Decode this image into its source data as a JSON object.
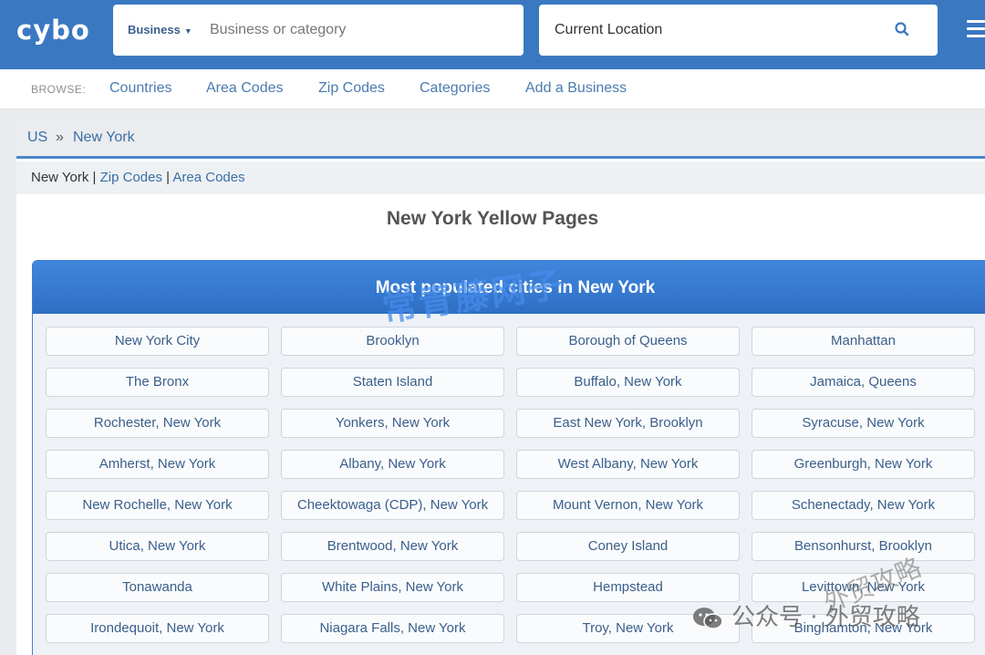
{
  "header": {
    "logo": "cybo",
    "search_type": "Business",
    "search_placeholder": "Business or category",
    "location": "Current Location"
  },
  "browse": {
    "label": "BROWSE:",
    "links": [
      "Countries",
      "Area Codes",
      "Zip Codes",
      "Categories",
      "Add a Business"
    ]
  },
  "breadcrumb": {
    "root": "US",
    "separator": "»",
    "current": "New York"
  },
  "subnav": {
    "current": "New York",
    "sep": " | ",
    "zip": "Zip Codes",
    "area": "Area Codes"
  },
  "page_title": "New York Yellow Pages",
  "cities": {
    "heading": "Most populated cities in New York",
    "items": [
      "New York City",
      "Brooklyn",
      "Borough of Queens",
      "Manhattan",
      "The Bronx",
      "Staten Island",
      "Buffalo, New York",
      "Jamaica, Queens",
      "Rochester, New York",
      "Yonkers, New York",
      "East New York, Brooklyn",
      "Syracuse, New York",
      "Amherst, New York",
      "Albany, New York",
      "West Albany, New York",
      "Greenburgh, New York",
      "New Rochelle, New York",
      "Cheektowaga (CDP), New York",
      "Mount Vernon, New York",
      "Schenectady, New York",
      "Utica, New York",
      "Brentwood, New York",
      "Coney Island",
      "Bensonhurst, Brooklyn",
      "Tonawanda",
      "White Plains, New York",
      "Hempstead",
      "Levittown, New York",
      "Irondequoit, New York",
      "Niagara Falls, New York",
      "Troy, New York",
      "Binghamton, New York"
    ]
  },
  "watermarks": {
    "main": "常青藤网子",
    "corner": "公众号 · 外贸攻略",
    "diagonal": "外贸攻略"
  }
}
